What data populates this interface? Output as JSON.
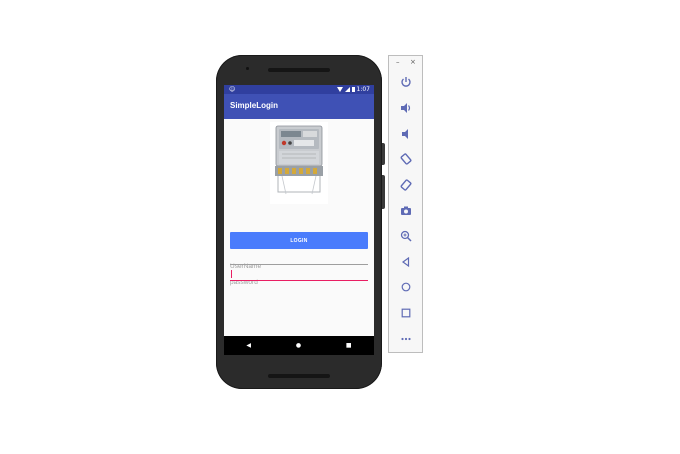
{
  "statusbar": {
    "left_icon": "☺",
    "time": "1:07"
  },
  "app": {
    "title": "SimpleLogin"
  },
  "form": {
    "username_placeholder": "UserName",
    "password_placeholder": "password",
    "login_label": "LOGIN"
  },
  "navbar": {
    "back": "◀",
    "home": "●",
    "recents": "■"
  },
  "panel": {
    "minimize": "–",
    "close": "×",
    "tools": [
      "power-icon",
      "volume-up-icon",
      "volume-down-icon",
      "rotate-left-icon",
      "rotate-right-icon",
      "camera-icon",
      "zoom-icon",
      "back-icon",
      "home-icon",
      "overview-icon",
      "more-icon"
    ]
  },
  "colors": {
    "appbar": "#3f51b5",
    "statusbar": "#303f9f",
    "button": "#4a7cfc",
    "accent": "#e91e63"
  }
}
